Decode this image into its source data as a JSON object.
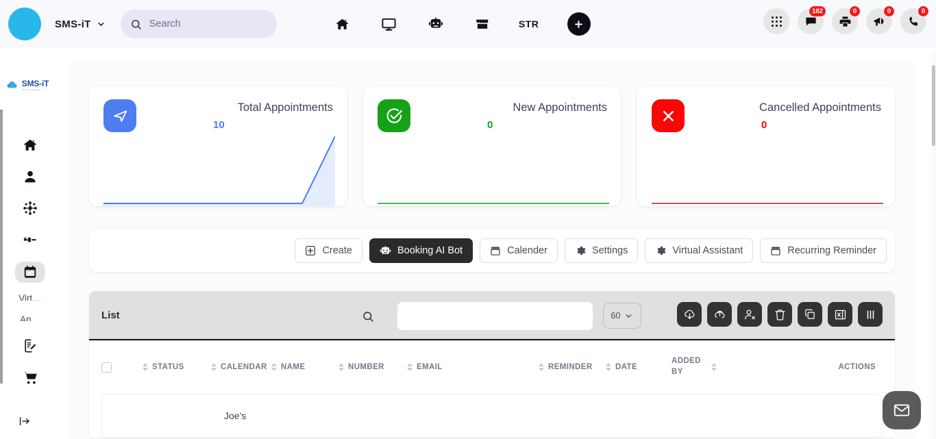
{
  "topbar": {
    "brand": "SMS-iT",
    "brand_caret_icon": "chevron-down-icon",
    "search": {
      "placeholder": "Search",
      "value": "",
      "icon": "search-icon"
    },
    "nav_items": [
      {
        "name": "home",
        "icon": "home-icon",
        "label": ""
      },
      {
        "name": "monitor",
        "icon": "monitor-icon",
        "label": ""
      },
      {
        "name": "ai-bot",
        "icon": "robot-icon",
        "label": ""
      },
      {
        "name": "store",
        "icon": "store-icon",
        "label": ""
      },
      {
        "name": "str",
        "icon": "text-icon",
        "label": "STR"
      }
    ],
    "add_button": {
      "label": "+",
      "icon": "plus-icon"
    },
    "right_items": [
      {
        "name": "apps",
        "icon": "grid-apps-icon",
        "badge": ""
      },
      {
        "name": "messages",
        "icon": "chat-icon",
        "badge": "182"
      },
      {
        "name": "print",
        "icon": "printer-icon",
        "badge": "0"
      },
      {
        "name": "announcements",
        "icon": "megaphone-icon",
        "badge": "0"
      },
      {
        "name": "calls",
        "icon": "phone-icon",
        "badge": "0"
      }
    ],
    "badge_color": "#f01c1c"
  },
  "sidebar": {
    "logo_text": "SMS-iT",
    "logo_sub": "Do the Business: iT",
    "items": [
      {
        "name": "home",
        "icon": "home-icon",
        "label": "",
        "active": false
      },
      {
        "name": "contacts",
        "icon": "person-icon",
        "label": "",
        "active": false
      },
      {
        "name": "network",
        "icon": "network-icon",
        "label": "",
        "active": false
      },
      {
        "name": "pipeline",
        "icon": "pipeline-icon",
        "label": "",
        "active": false
      },
      {
        "name": "appointments",
        "icon": "calendar-check-icon",
        "label": "",
        "active": true
      }
    ],
    "text_items": [
      {
        "name": "virtual",
        "label": "Virt…"
      },
      {
        "name": "apps",
        "label": "Ap…"
      }
    ],
    "bottom_items": [
      {
        "name": "forms",
        "icon": "document-edit-icon",
        "label": ""
      },
      {
        "name": "store",
        "icon": "shopping-cart-icon",
        "label": ""
      }
    ],
    "collapse": {
      "name": "collapse",
      "icon": "expand-arrow-icon",
      "label": ""
    }
  },
  "stats": [
    {
      "title": "Total Appointments",
      "value": "10",
      "icon": "send-icon",
      "icon_bg": "#4e7df0",
      "value_color": "#4e7df0",
      "line_color": "#4e7df0",
      "fill_color": "#e4ecfd",
      "has_spark": true
    },
    {
      "title": "New Appointments",
      "value": "0",
      "icon": "check-circle-icon",
      "icon_bg": "#16a118",
      "value_color": "#16a118",
      "line_color": "#16a118",
      "fill_color": "#eaf7ea",
      "has_spark": false
    },
    {
      "title": "Cancelled Appointments",
      "value": "0",
      "icon": "close-x-icon",
      "icon_bg": "#fb0606",
      "value_color": "#fb0606",
      "line_color": "#a52020",
      "fill_color": "#fdeaea",
      "has_spark": false
    }
  ],
  "chart_data": {
    "type": "area",
    "title": "Total Appointments sparkline",
    "x": [
      0,
      1,
      2,
      3,
      4,
      5,
      6,
      7,
      8
    ],
    "values": [
      0,
      0,
      0,
      0,
      0,
      0,
      0,
      0,
      10
    ],
    "ylim": [
      0,
      10
    ],
    "xlabel": "",
    "ylabel": "",
    "grid": false,
    "legend": "none",
    "line_color": "#4e7df0",
    "fill_color": "#e4ecfd"
  },
  "toolbar": {
    "buttons": [
      {
        "label": "Create",
        "icon": "plus-square-icon",
        "active": false
      },
      {
        "label": "Booking AI Bot",
        "icon": "robot-icon",
        "active": true
      },
      {
        "label": "Calender",
        "icon": "calendar-icon",
        "active": false
      },
      {
        "label": "Settings",
        "icon": "gear-icon",
        "active": false
      },
      {
        "label": "Virtual Assistant",
        "icon": "gear-icon",
        "active": false
      },
      {
        "label": "Recurring Reminder",
        "icon": "calendar-icon",
        "active": false
      }
    ]
  },
  "list": {
    "title": "List",
    "search": {
      "placeholder": "",
      "value": "",
      "icon": "search-icon"
    },
    "page_size": "60",
    "page_size_caret": "chevron-down-icon",
    "actions": [
      {
        "name": "download",
        "icon": "cloud-download-icon"
      },
      {
        "name": "upload",
        "icon": "cloud-upload-icon"
      },
      {
        "name": "remove-user",
        "icon": "user-remove-icon"
      },
      {
        "name": "delete",
        "icon": "trash-icon"
      },
      {
        "name": "duplicate",
        "icon": "copy-icon"
      },
      {
        "name": "export-excel",
        "icon": "excel-export-icon"
      },
      {
        "name": "columns",
        "icon": "columns-icon"
      }
    ],
    "columns": [
      {
        "key": "select",
        "label": "",
        "sortable": false
      },
      {
        "key": "status",
        "label": "STATUS",
        "sortable": true
      },
      {
        "key": "calendar",
        "label": "CALENDAR",
        "sortable": true
      },
      {
        "key": "name",
        "label": "NAME",
        "sortable": true
      },
      {
        "key": "number",
        "label": "NUMBER",
        "sortable": true
      },
      {
        "key": "email",
        "label": "EMAIL",
        "sortable": true
      },
      {
        "key": "reminder",
        "label": "REMINDER",
        "sortable": true
      },
      {
        "key": "date",
        "label": "DATE",
        "sortable": true
      },
      {
        "key": "added_by",
        "label": "ADDED BY",
        "sortable": true
      },
      {
        "key": "actions",
        "label": "ACTIONS",
        "sortable": false
      }
    ],
    "rows": [
      {
        "status": "",
        "calendar": "Joe's",
        "name": "",
        "number": "",
        "email": "",
        "reminder": "",
        "date": "",
        "added_by": ""
      }
    ]
  },
  "fab": {
    "name": "mail",
    "icon": "envelope-icon",
    "color": "#5a5a5a"
  }
}
